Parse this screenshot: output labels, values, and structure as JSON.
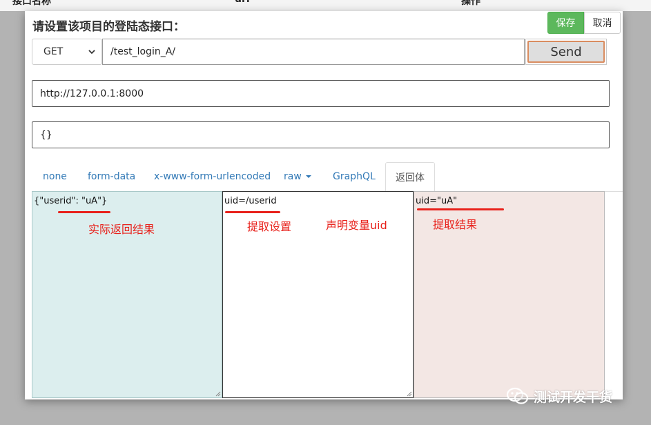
{
  "background": {
    "col1": "接口名称",
    "col2": "url",
    "col3": "操作"
  },
  "modal": {
    "title": "请设置该项目的登陆态接口：",
    "save_label": "保存",
    "cancel_label": "取消",
    "method": "GET",
    "url_value": "/test_login_A/",
    "send_label": "Send",
    "host_value": "http://127.0.0.1:8000",
    "body_value": "{}",
    "tabs": [
      "none",
      "form-data",
      "x-www-form-urlencoded",
      "raw",
      "GraphQL",
      "返回体"
    ],
    "active_tab": "返回体",
    "panels": {
      "response": "{\"userid\": \"uA\"}",
      "extract_setting": "uid=/userid",
      "extract_result": "uid=\"uA\""
    }
  },
  "annotations": {
    "actual_response": "实际返回结果",
    "extract_setting": "提取设置",
    "declare_variable": "声明变量uid",
    "extract_result": "提取结果",
    "color": "#e8211b"
  },
  "watermark": {
    "text": "测试开发干货",
    "icon": "wechat-icon"
  },
  "colors": {
    "save": "#5cb85c",
    "link": "#337ab7",
    "panel_response_bg": "#dceeee",
    "panel_result_bg": "#f3e7e4",
    "send_border": "#d98c5f"
  }
}
